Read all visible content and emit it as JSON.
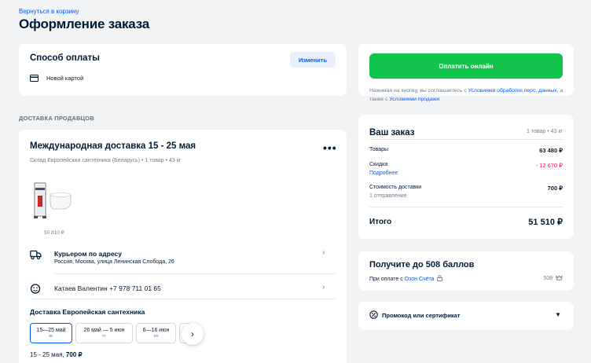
{
  "header": {
    "back_link": "Вернуться в корзину",
    "title": "Оформление заказа"
  },
  "payment": {
    "title": "Способ оплаты",
    "change_label": "Изменить",
    "method": "Новой картой"
  },
  "sellers_section": "ДОСТАВКА ПРОДАВЦОВ",
  "delivery": {
    "title": "Международная доставка 15 - 25 мая",
    "subtitle": "Склад Европейская сантехника (Беларусь) • 1 товар • 43 кг",
    "product_price": "50 810 ₽",
    "courier_title": "Курьером по адресу",
    "courier_address": "Россия, Москва, улица Ленинская Слобода, 26",
    "recipient": "Катаев Валентин +7 978 711 01 65",
    "group_title": "Доставка Европейская сантехника",
    "slots": [
      {
        "date": "15—25 май",
        "weekday": "вс"
      },
      {
        "date": "26 май — 5 июн",
        "weekday": "чт"
      },
      {
        "date": "6—16 июн",
        "weekday": "пн"
      }
    ],
    "slot_summary_date": "15 - 25 мая,",
    "slot_summary_price": "700 ₽"
  },
  "checkout": {
    "pay_button": "Оплатить онлайн",
    "agree_prefix": "Нажимая на кнопку, вы соглашаетесь с ",
    "agree_link1": "Условиями обработки перс. данных",
    "agree_mid": ", а также с ",
    "agree_link2": "Условиями продажи"
  },
  "order": {
    "title": "Ваш заказ",
    "meta": "1 товар • 43 кг",
    "goods_label": "Товары",
    "goods_value": "63 480 ₽",
    "discount_label": "Скидка",
    "discount_value": "- 12 670 ₽",
    "discount_more": "Подробнее",
    "shipping_label": "Стоимость доставки",
    "shipping_value": "700 ₽",
    "shipping_sub": "1 отправление",
    "total_label": "Итого",
    "total_value": "51 510 ₽"
  },
  "points": {
    "title": "Получите до 508 баллов",
    "sub_prefix": "При оплате с ",
    "sub_link": "Озон Счёта",
    "value": "508"
  },
  "promo": {
    "label": "Промокод или сертификат"
  },
  "colors": {
    "accent": "#005bff",
    "pay_button": "#10c44c",
    "discount": "#f91155"
  }
}
